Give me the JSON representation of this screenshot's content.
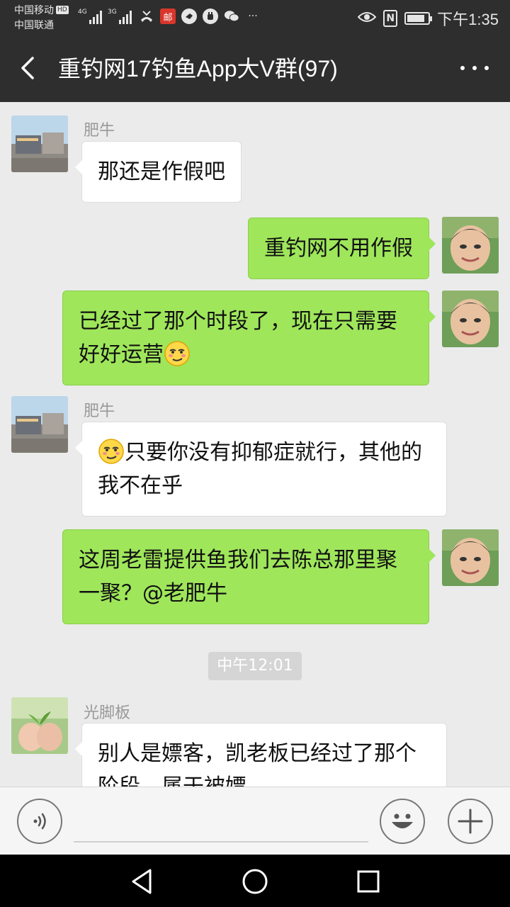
{
  "status_bar": {
    "carrier_1": "中国移动",
    "carrier_2": "中国联通",
    "hd_badge": "HD",
    "signal_1_label": "4G",
    "signal_2_label": "3G",
    "mail_icon_text": "邮",
    "more_indicator": "···",
    "time": "下午1:35",
    "nfc_label": "N",
    "battery_level": 0.85
  },
  "header": {
    "title": "重钓网17钓鱼App大V群(97)"
  },
  "messages": [
    {
      "side": "in",
      "sender": "肥牛",
      "text": "那还是作假吧"
    },
    {
      "side": "out",
      "text": "重钓网不用作假"
    },
    {
      "side": "out",
      "text": "已经过了那个时段了，现在只需要好好运营",
      "emoji": "smug-face-emoji"
    },
    {
      "side": "in",
      "sender": "肥牛",
      "text": "只要你没有抑郁症就行，其他的我不在乎",
      "emoji": "smug-face-emoji"
    },
    {
      "side": "out",
      "text": "这周老雷提供鱼我们去陈总那里聚一聚？@老肥牛"
    },
    {
      "side": "in",
      "sender": "光脚板",
      "text": "别人是嫖客，凯老板已经过了那个阶段，属于被嫖"
    }
  ],
  "timestamp_divider": "中午12:01",
  "m3_line1": "已经过了那个时段了，现在只需要",
  "m3_line2": "好好运营",
  "m4_line1": "只要你没有抑郁症就行，其他的",
  "m4_line2": "我不在乎",
  "m5_line1": "这周老雷提供鱼我们去陈总那里聚",
  "m5_line2": "一聚？@老肥牛",
  "m6_line1": "别人是嫖客，凯老板已经过了那个",
  "m6_line2": "阶段，属于被嫖",
  "input": {
    "value": "",
    "placeholder": ""
  },
  "colors": {
    "header_bg": "#2e2e2e",
    "chat_bg": "#ebebeb",
    "outgoing_bubble": "#9fe65b",
    "incoming_bubble": "#ffffff"
  },
  "icons": [
    "back-arrow-icon",
    "more-dots-icon",
    "voice-icon",
    "emoji-icon",
    "plus-icon",
    "nav-back-icon",
    "nav-home-icon",
    "nav-recent-icon"
  ]
}
